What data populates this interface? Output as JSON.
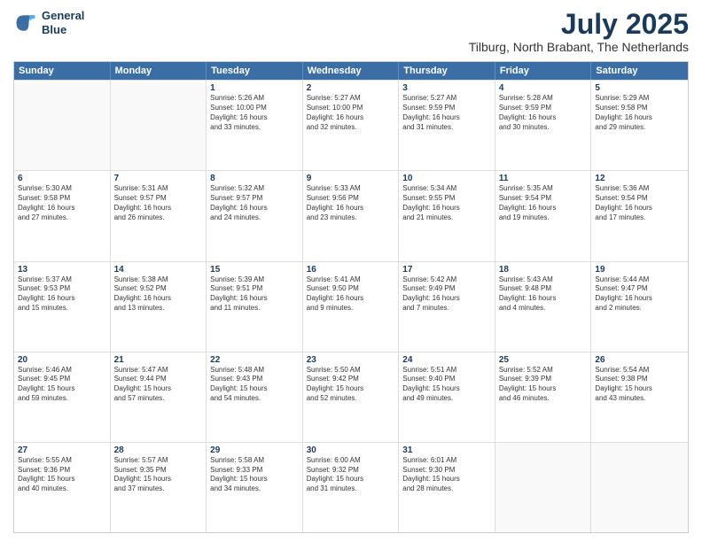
{
  "logo": {
    "line1": "General",
    "line2": "Blue"
  },
  "title": "July 2025",
  "location": "Tilburg, North Brabant, The Netherlands",
  "days": [
    "Sunday",
    "Monday",
    "Tuesday",
    "Wednesday",
    "Thursday",
    "Friday",
    "Saturday"
  ],
  "weeks": [
    [
      {
        "day": "",
        "content": ""
      },
      {
        "day": "",
        "content": ""
      },
      {
        "day": "1",
        "content": "Sunrise: 5:26 AM\nSunset: 10:00 PM\nDaylight: 16 hours\nand 33 minutes."
      },
      {
        "day": "2",
        "content": "Sunrise: 5:27 AM\nSunset: 10:00 PM\nDaylight: 16 hours\nand 32 minutes."
      },
      {
        "day": "3",
        "content": "Sunrise: 5:27 AM\nSunset: 9:59 PM\nDaylight: 16 hours\nand 31 minutes."
      },
      {
        "day": "4",
        "content": "Sunrise: 5:28 AM\nSunset: 9:59 PM\nDaylight: 16 hours\nand 30 minutes."
      },
      {
        "day": "5",
        "content": "Sunrise: 5:29 AM\nSunset: 9:58 PM\nDaylight: 16 hours\nand 29 minutes."
      }
    ],
    [
      {
        "day": "6",
        "content": "Sunrise: 5:30 AM\nSunset: 9:58 PM\nDaylight: 16 hours\nand 27 minutes."
      },
      {
        "day": "7",
        "content": "Sunrise: 5:31 AM\nSunset: 9:57 PM\nDaylight: 16 hours\nand 26 minutes."
      },
      {
        "day": "8",
        "content": "Sunrise: 5:32 AM\nSunset: 9:57 PM\nDaylight: 16 hours\nand 24 minutes."
      },
      {
        "day": "9",
        "content": "Sunrise: 5:33 AM\nSunset: 9:56 PM\nDaylight: 16 hours\nand 23 minutes."
      },
      {
        "day": "10",
        "content": "Sunrise: 5:34 AM\nSunset: 9:55 PM\nDaylight: 16 hours\nand 21 minutes."
      },
      {
        "day": "11",
        "content": "Sunrise: 5:35 AM\nSunset: 9:54 PM\nDaylight: 16 hours\nand 19 minutes."
      },
      {
        "day": "12",
        "content": "Sunrise: 5:36 AM\nSunset: 9:54 PM\nDaylight: 16 hours\nand 17 minutes."
      }
    ],
    [
      {
        "day": "13",
        "content": "Sunrise: 5:37 AM\nSunset: 9:53 PM\nDaylight: 16 hours\nand 15 minutes."
      },
      {
        "day": "14",
        "content": "Sunrise: 5:38 AM\nSunset: 9:52 PM\nDaylight: 16 hours\nand 13 minutes."
      },
      {
        "day": "15",
        "content": "Sunrise: 5:39 AM\nSunset: 9:51 PM\nDaylight: 16 hours\nand 11 minutes."
      },
      {
        "day": "16",
        "content": "Sunrise: 5:41 AM\nSunset: 9:50 PM\nDaylight: 16 hours\nand 9 minutes."
      },
      {
        "day": "17",
        "content": "Sunrise: 5:42 AM\nSunset: 9:49 PM\nDaylight: 16 hours\nand 7 minutes."
      },
      {
        "day": "18",
        "content": "Sunrise: 5:43 AM\nSunset: 9:48 PM\nDaylight: 16 hours\nand 4 minutes."
      },
      {
        "day": "19",
        "content": "Sunrise: 5:44 AM\nSunset: 9:47 PM\nDaylight: 16 hours\nand 2 minutes."
      }
    ],
    [
      {
        "day": "20",
        "content": "Sunrise: 5:46 AM\nSunset: 9:45 PM\nDaylight: 15 hours\nand 59 minutes."
      },
      {
        "day": "21",
        "content": "Sunrise: 5:47 AM\nSunset: 9:44 PM\nDaylight: 15 hours\nand 57 minutes."
      },
      {
        "day": "22",
        "content": "Sunrise: 5:48 AM\nSunset: 9:43 PM\nDaylight: 15 hours\nand 54 minutes."
      },
      {
        "day": "23",
        "content": "Sunrise: 5:50 AM\nSunset: 9:42 PM\nDaylight: 15 hours\nand 52 minutes."
      },
      {
        "day": "24",
        "content": "Sunrise: 5:51 AM\nSunset: 9:40 PM\nDaylight: 15 hours\nand 49 minutes."
      },
      {
        "day": "25",
        "content": "Sunrise: 5:52 AM\nSunset: 9:39 PM\nDaylight: 15 hours\nand 46 minutes."
      },
      {
        "day": "26",
        "content": "Sunrise: 5:54 AM\nSunset: 9:38 PM\nDaylight: 15 hours\nand 43 minutes."
      }
    ],
    [
      {
        "day": "27",
        "content": "Sunrise: 5:55 AM\nSunset: 9:36 PM\nDaylight: 15 hours\nand 40 minutes."
      },
      {
        "day": "28",
        "content": "Sunrise: 5:57 AM\nSunset: 9:35 PM\nDaylight: 15 hours\nand 37 minutes."
      },
      {
        "day": "29",
        "content": "Sunrise: 5:58 AM\nSunset: 9:33 PM\nDaylight: 15 hours\nand 34 minutes."
      },
      {
        "day": "30",
        "content": "Sunrise: 6:00 AM\nSunset: 9:32 PM\nDaylight: 15 hours\nand 31 minutes."
      },
      {
        "day": "31",
        "content": "Sunrise: 6:01 AM\nSunset: 9:30 PM\nDaylight: 15 hours\nand 28 minutes."
      },
      {
        "day": "",
        "content": ""
      },
      {
        "day": "",
        "content": ""
      }
    ]
  ]
}
